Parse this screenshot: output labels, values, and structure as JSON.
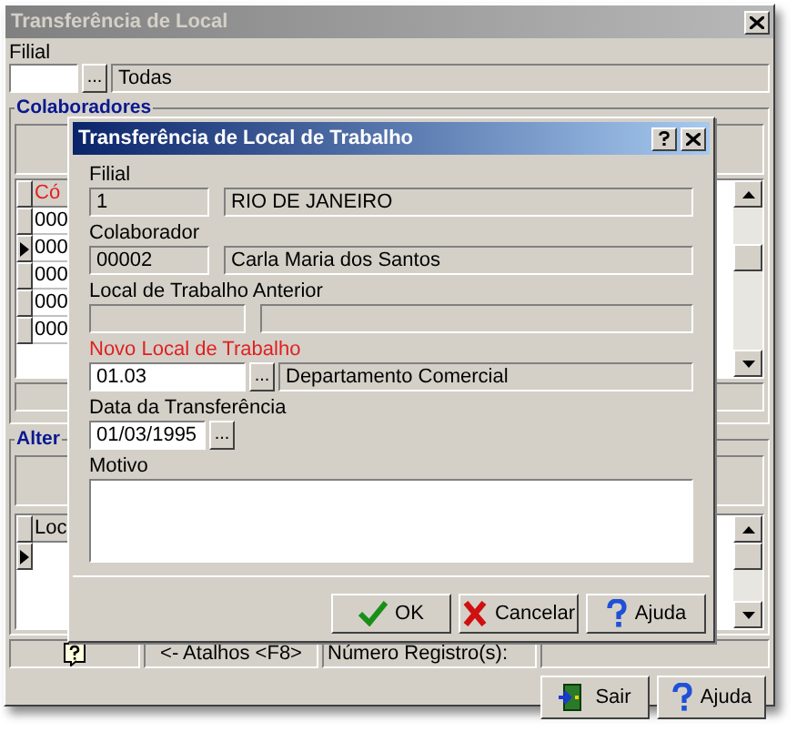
{
  "window": {
    "title": "Transferência de Local"
  },
  "filter": {
    "label": "Filial",
    "lookup": "...",
    "description": "Todas"
  },
  "colaboradores": {
    "title": "Colaboradores",
    "columns": [
      "Có"
    ],
    "rows": [
      {
        "cells": [
          "000"
        ],
        "selected": false
      },
      {
        "cells": [
          "000"
        ],
        "selected": true
      },
      {
        "cells": [
          "000"
        ],
        "selected": false
      },
      {
        "cells": [
          "000"
        ],
        "selected": false
      },
      {
        "cells": [
          "000"
        ],
        "selected": false
      }
    ]
  },
  "alteracoes": {
    "title": "Alter",
    "columns": [
      "Loc"
    ],
    "rows": [
      {
        "cells": [],
        "selected": true
      }
    ]
  },
  "status_bar": {
    "shortcuts": "<- Atalhos <F8>",
    "records": "Número Registro(s):"
  },
  "buttons": [
    {
      "label": "Sair",
      "kind": "exit"
    },
    {
      "label": "Ajuda",
      "kind": "help"
    }
  ],
  "dialog": {
    "title": "Transferência de Local de Trabalho",
    "fields": [
      {
        "label": "Filial",
        "required": false,
        "kind": "line",
        "inputs": [
          {
            "value": "1",
            "editable": false
          },
          {
            "value": "RIO DE JANEIRO",
            "editable": false
          }
        ]
      },
      {
        "label": "Colaborador",
        "required": false,
        "kind": "line",
        "inputs": [
          {
            "value": "00002",
            "editable": false
          },
          {
            "value": "Carla Maria dos Santos",
            "editable": false
          }
        ]
      },
      {
        "label": "Local de Trabalho Anterior",
        "required": false,
        "kind": "line",
        "inputs": [
          {
            "editable": false
          },
          {
            "editable": false
          }
        ]
      },
      {
        "label": "Novo Local de Trabalho",
        "required": true,
        "kind": "line",
        "inputs": [
          {
            "value": "01.03",
            "editable": true,
            "lookup": "..."
          },
          {
            "value": "Departamento Comercial",
            "editable": false
          }
        ]
      },
      {
        "label": "Data da Transferência",
        "required": false,
        "kind": "line",
        "inputs": [
          {
            "value": "01/03/1995",
            "editable": true,
            "lookup": "..."
          }
        ]
      },
      {
        "label": "Motivo",
        "required": false,
        "kind": "memo",
        "inputs": [
          {
            "editable": true
          }
        ]
      }
    ],
    "buttons": [
      {
        "label": "OK",
        "kind": "ok"
      },
      {
        "label": "Cancelar",
        "kind": "cancel"
      },
      {
        "label": "Ajuda",
        "kind": "help"
      }
    ]
  }
}
